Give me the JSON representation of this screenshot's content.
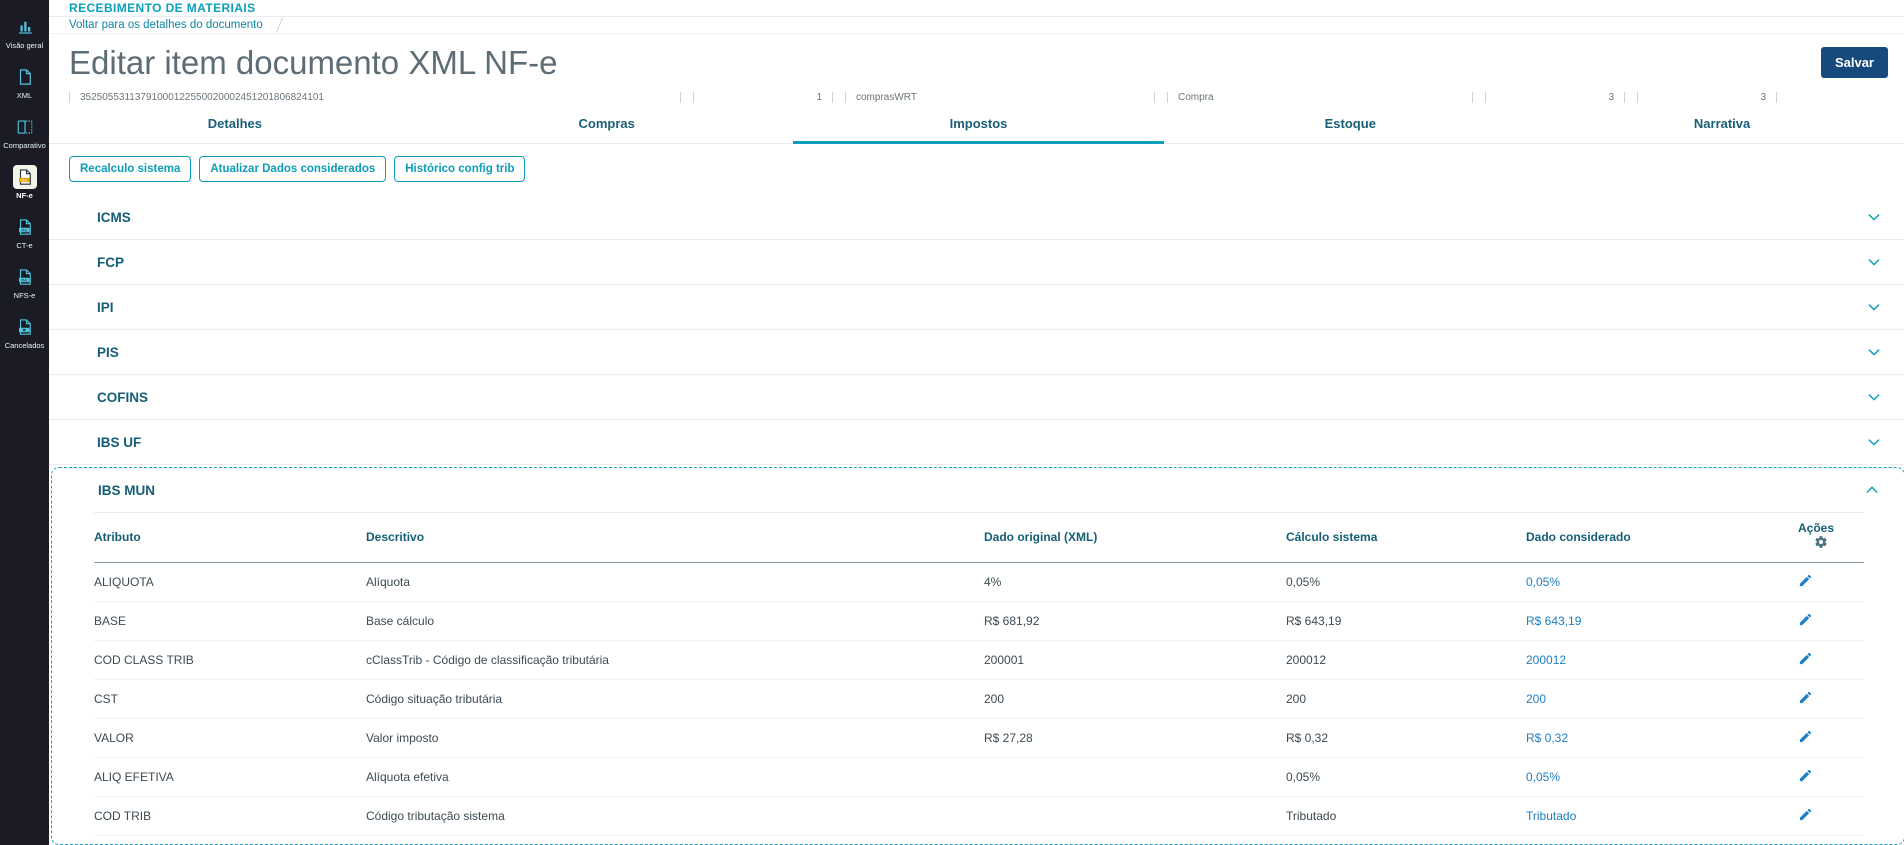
{
  "sidebar": {
    "items": [
      {
        "label": "Visão geral",
        "icon": "bar-chart",
        "active": false
      },
      {
        "label": "XML",
        "icon": "xml-file",
        "active": false
      },
      {
        "label": "Comparativo",
        "icon": "compare-files",
        "active": false
      },
      {
        "label": "NF-e",
        "icon": "nfe-file",
        "active": true
      },
      {
        "label": "CT-e",
        "icon": "cte-file",
        "active": false
      },
      {
        "label": "NFS-e",
        "icon": "nfse-file",
        "active": false
      },
      {
        "label": "Cancelados",
        "icon": "cancelados-file",
        "active": false
      }
    ]
  },
  "header": {
    "module_title": "RECEBIMENTO DE MATERIAIS",
    "breadcrumb_back": "Voltar para os detalhes do documento",
    "page_title": "Editar item documento XML NF-e",
    "save_button": "Salvar"
  },
  "form_fields": {
    "chave_acesso": "35250553113791000122550020002451201806824101",
    "item": "1",
    "usuario": "comprasWRT",
    "tipo": "Compra",
    "qtd1": "3",
    "qtd2": "3"
  },
  "tabs": [
    {
      "label": "Detalhes",
      "active": false
    },
    {
      "label": "Compras",
      "active": false
    },
    {
      "label": "Impostos",
      "active": true
    },
    {
      "label": "Estoque",
      "active": false
    },
    {
      "label": "Narrativa",
      "active": false
    }
  ],
  "toolbar": [
    {
      "label": "Recalculo sistema"
    },
    {
      "label": "Atualizar Dados considerados"
    },
    {
      "label": "Histórico config trib"
    }
  ],
  "accordions": [
    {
      "label": "ICMS",
      "expanded": false
    },
    {
      "label": "FCP",
      "expanded": false
    },
    {
      "label": "IPI",
      "expanded": false
    },
    {
      "label": "PIS",
      "expanded": false
    },
    {
      "label": "COFINS",
      "expanded": false
    },
    {
      "label": "IBS UF",
      "expanded": false
    },
    {
      "label": "IBS MUN",
      "expanded": true
    }
  ],
  "tax_table": {
    "columns": {
      "atributo": "Atributo",
      "descritivo": "Descritivo",
      "original": "Dado original (XML)",
      "calculo": "Cálculo sistema",
      "considerado": "Dado considerado",
      "acoes": "Ações"
    },
    "rows": [
      {
        "atributo": "ALIQUOTA",
        "descritivo": "Alíquota",
        "original": "4%",
        "calculo": "0,05%",
        "considerado": "0,05%"
      },
      {
        "atributo": "BASE",
        "descritivo": "Base cálculo",
        "original": "R$ 681,92",
        "calculo": "R$ 643,19",
        "considerado": "R$ 643,19"
      },
      {
        "atributo": "COD CLASS TRIB",
        "descritivo": "cClassTrib - Código de classificação tributária",
        "original": "200001",
        "calculo": "200012",
        "considerado": "200012"
      },
      {
        "atributo": "CST",
        "descritivo": "Código situação tributária",
        "original": "200",
        "calculo": "200",
        "considerado": "200"
      },
      {
        "atributo": "VALOR",
        "descritivo": "Valor imposto",
        "original": "R$ 27,28",
        "calculo": "R$ 0,32",
        "considerado": "R$ 0,32"
      },
      {
        "atributo": "ALIQ EFETIVA",
        "descritivo": "Alíquota efetiva",
        "original": "",
        "calculo": "0,05%",
        "considerado": "0,05%"
      },
      {
        "atributo": "COD TRIB",
        "descritivo": "Código tributação sistema",
        "original": "",
        "calculo": "Tributado",
        "considerado": "Tributado"
      }
    ]
  },
  "colors": {
    "accent_teal": "#0c9eb8",
    "heading_blue": "#155e75",
    "link_blue": "#1d7fc4",
    "save_button_bg": "#174a7c",
    "sidebar_bg": "#1b1b25"
  }
}
